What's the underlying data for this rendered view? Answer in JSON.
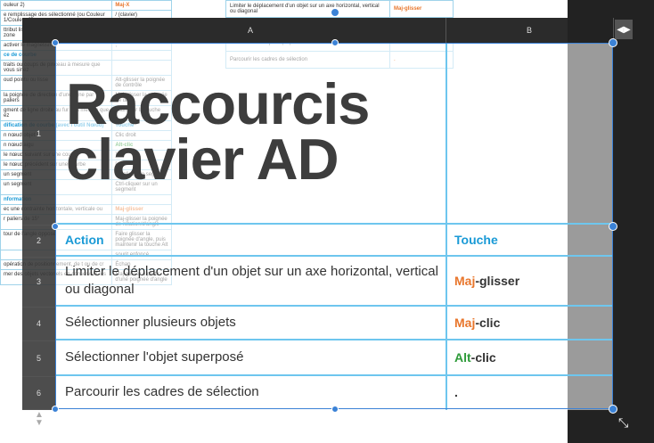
{
  "background_doc": {
    "left_rows": [
      {
        "a": "ouleur 2)",
        "b": "Maj-X",
        "b_class": "k-orange"
      },
      {
        "a": "e remplissage des sélectionné (ou Couleur 1/Couleur 2)",
        "b": "/ (clavier)",
        "b_class": ""
      },
      {
        "a": "ttribut listé dans une sous-fenêtre ou une zone",
        "b": "Faire glisser le libellé d'un attribut",
        "b_class": ""
      },
      {
        "a": "activer le magnétisme",
        "b": ";",
        "b_class": ""
      },
      {
        "a": "ce de courbe",
        "b": "",
        "b_class": "",
        "head": true
      },
      {
        "a": "traits ou coups de pinceau à mesure que vous sinez",
        "b": "",
        "b_class": ""
      },
      {
        "a": "oud pointu ou lisse",
        "b": "Alt-glisser la poignée de contrôle",
        "b_class": ""
      },
      {
        "a": "la poignée de direction d'une ligne par paliers",
        "b": "Maj-glisser la poignée de dir",
        "b_class": ""
      },
      {
        "a": "gment de ligne droite au fur et à mesure que ez",
        "b": "Maintenir la touche",
        "b_class": ""
      },
      {
        "a": "dification de courbe (avec l'outil Nœud)",
        "b": "Touche",
        "b_class": "",
        "head": true
      },
      {
        "a": "n nœud objet",
        "b": "Clic droit",
        "b_class": ""
      },
      {
        "a": "n nœud aigu",
        "b": "Alt-clic",
        "b_class": "k-green"
      },
      {
        "a": "le nœud suivant sur une courbe",
        "b": "]",
        "b_class": ""
      },
      {
        "a": "le nœud précédent sur une courbe",
        "b": "[",
        "b_class": ""
      },
      {
        "a": "un segment",
        "b": "Alt-glisser le segment",
        "b_class": ""
      },
      {
        "a": "un segment",
        "b": "Ctrl-cliquer sur un segment",
        "b_class": ""
      },
      {
        "a": "nformation",
        "b": "",
        "b_class": "",
        "head": true
      },
      {
        "a": "ec une contrainte horizontale, verticale ou",
        "b": "Maj-glisser",
        "b_class": "k-orange"
      },
      {
        "a": "r paliers de 15°",
        "b": "Maj-glisser la poignée de rotation/d'angle",
        "b_class": ""
      },
      {
        "a": "tour de l'angle opposé",
        "b": "Faire glisser la poignée d'angle, puis maintenir la touche Alt",
        "b_class": ""
      },
      {
        "a": "",
        "b": "sourit enfoncé",
        "b_class": ""
      },
      {
        "a": "opération de positionnement, de t ou de cr",
        "b": "Échap",
        "b_class": ""
      },
      {
        "a": "mer des objets vectoriels en conservant les",
        "b": "Maj-glisser à partir d'une poignée d'angle",
        "b_class": ""
      }
    ],
    "right_rows": [
      {
        "a": "Limiter le déplacement d'un objet sur un axe horizontal, vertical ou diagonal",
        "b": "Maj-glisser"
      },
      {
        "a": "Sélectionner plusieurs objets",
        "b": "Maj-clic"
      },
      {
        "a": "Sélectionner l'objet superposé",
        "b": "Alt-clic"
      },
      {
        "a": "Parcourir les cadres de sélection",
        "b": "."
      }
    ]
  },
  "grid": {
    "columns": [
      "A",
      "B"
    ],
    "rows": [
      "1",
      "2",
      "3",
      "4",
      "5",
      "6"
    ]
  },
  "table": {
    "title": "Raccourcis clavier AD",
    "header": {
      "action": "Action",
      "key": "Touche"
    },
    "rows": [
      {
        "action": "Limiter le déplacement d'un objet sur un axe horizontal, vertical ou diagonal",
        "key_mod": "Maj",
        "key_rest": "-glisser",
        "mod_color": "#e8762c"
      },
      {
        "action": "Sélectionner plusieurs objets",
        "key_mod": "Maj",
        "key_rest": "-clic",
        "mod_color": "#e8762c"
      },
      {
        "action": "Sélectionner l'objet superposé",
        "key_mod": "Alt",
        "key_rest": "-clic",
        "mod_color": "#2e9b3a"
      },
      {
        "action": "Parcourir les cadres de sélection",
        "key_mod": "",
        "key_rest": ".",
        "mod_color": "#333333"
      }
    ]
  },
  "colors": {
    "accent": "#1a9ad6",
    "selection": "#3b82d6",
    "maj": "#e8762c",
    "alt": "#2e9b3a"
  },
  "icons": {
    "scroll": "horizontal-resize-icon",
    "updown": "row-scroll-icon",
    "cursor": "resize-cursor-icon"
  }
}
